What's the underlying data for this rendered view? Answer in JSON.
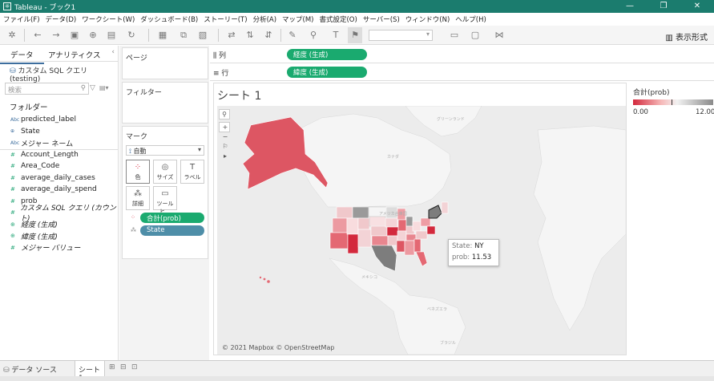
{
  "window": {
    "title": "Tableau - ブック1",
    "controls": [
      "—",
      "❐",
      "✕"
    ]
  },
  "menu": [
    "ファイル(F)",
    "データ(D)",
    "ワークシート(W)",
    "ダッシュボード(B)",
    "ストーリー(T)",
    "分析(A)",
    "マップ(M)",
    "書式設定(O)",
    "サーバー(S)",
    "ウィンドウ(N)",
    "ヘルプ(H)"
  ],
  "toolbar": {
    "show_me": "表示形式"
  },
  "left_pane": {
    "tab_data": "データ",
    "tab_analytics": "アナリティクス",
    "data_source": "カスタム SQL クエリ (testing)",
    "search_placeholder": "検索",
    "folder_label": "フォルダー",
    "dimensions": [
      "predicted_label",
      "State",
      "メジャー ネーム"
    ],
    "measures": [
      "Account_Length",
      "Area_Code",
      "average_daily_cases",
      "average_daily_spend",
      "prob",
      "カスタム SQL クエリ (カウント)",
      "経度 (生成)",
      "緯度 (生成)",
      "メジャー バリュー"
    ]
  },
  "shelves": {
    "pages": "ページ",
    "filters": "フィルター",
    "marks": "マーク",
    "mark_type": "自動",
    "mark_buttons": [
      "色",
      "サイズ",
      "ラベル",
      "詳細",
      "ツールヒ..."
    ],
    "mark_pills": [
      "合計(prob)",
      "State"
    ],
    "columns_label": "列",
    "columns_pill": "経度 (生成)",
    "rows_label": "行",
    "rows_pill": "緯度 (生成)"
  },
  "sheet": {
    "title": "シート 1",
    "copyright": "© 2021 Mapbox © OpenStreetMap",
    "map_labels": [
      "グリーンランド",
      "カナダ",
      "アメリカ合衆国",
      "メキシコ",
      "ベネズエラ",
      "ブラジル"
    ],
    "tooltip": {
      "state_key": "State:",
      "state_value": "NY",
      "prob_key": "prob:",
      "prob_value": "11.53"
    }
  },
  "legend": {
    "title": "合計(prob)",
    "min": "0.00",
    "max": "12.00"
  },
  "bottom": {
    "data_source_tab": "データ ソース",
    "sheet_tab": "シート 1"
  },
  "colors": {
    "titlebar": "#1b7c6e",
    "pill_green": "#1aaa6f",
    "pill_blue": "#4e8ea8",
    "map_red": "#d3293d",
    "map_gray": "#8a8a8a"
  }
}
